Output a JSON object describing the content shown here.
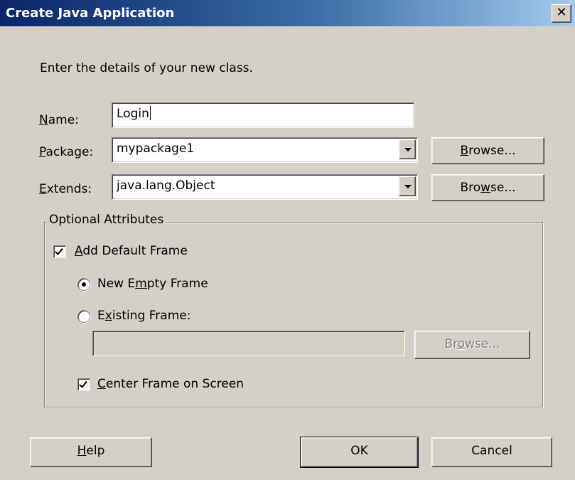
{
  "window": {
    "title": "Create Java Application",
    "close_glyph": "✕"
  },
  "intro": "Enter the details of your new class.",
  "name": {
    "label_mn": "N",
    "label_rest": "ame:",
    "value": "Login"
  },
  "package": {
    "label_mn": "P",
    "label_rest": "ackage:",
    "value": "mypackage1",
    "browse_mn": "B",
    "browse_rest": "rowse..."
  },
  "extends": {
    "label_mn": "E",
    "label_rest": "xtends:",
    "value": "java.lang.Object",
    "browse_pre": "Bro",
    "browse_mn": "w",
    "browse_rest": "se..."
  },
  "optional": {
    "legend": "Optional Attributes",
    "add_default_frame": {
      "pre": "",
      "mn": "A",
      "rest": "dd Default Frame",
      "checked": true
    },
    "new_empty_frame": {
      "pre": "New E",
      "mn": "m",
      "rest": "pty Frame",
      "selected": true
    },
    "existing_frame": {
      "pre": "E",
      "mn": "x",
      "rest": "isting Frame:",
      "selected": false,
      "value": ""
    },
    "existing_browse": {
      "pre": "Br",
      "mn": "o",
      "rest": "wse...",
      "enabled": false
    },
    "center_frame": {
      "pre": "",
      "mn": "C",
      "rest": "enter Frame on Screen",
      "checked": true
    }
  },
  "buttons": {
    "help": {
      "mn": "H",
      "rest": "elp"
    },
    "ok": "OK",
    "cancel": "Cancel"
  }
}
